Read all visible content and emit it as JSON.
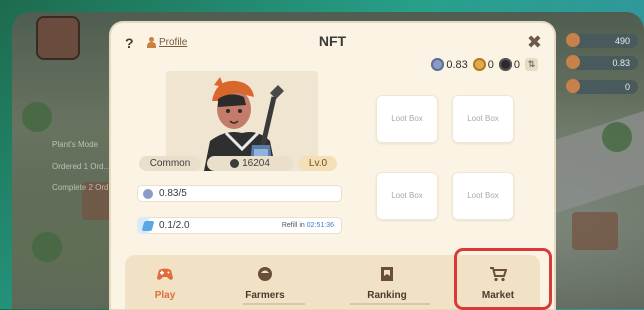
{
  "modal": {
    "title": "NFT",
    "help_symbol": "?",
    "profile_label": "Profile",
    "close_symbol": "✖"
  },
  "currencies": [
    {
      "icon": "token-icon",
      "value": "0.83",
      "color": "#8a9cc4"
    },
    {
      "icon": "gold-coin-icon",
      "value": "0",
      "color": "#e0a94a"
    },
    {
      "icon": "black-coin-icon",
      "value": "0",
      "color": "#2b2b2b"
    }
  ],
  "nft": {
    "rarity": "Common",
    "power": "16204",
    "level": "Lv.0",
    "hp": "0.83/5",
    "energy": "0.1/2.0",
    "refill_label": "Refill in",
    "refill_time": "02:51:36"
  },
  "lootboxes": [
    "Loot Box",
    "Loot Box",
    "Loot Box",
    "Loot Box"
  ],
  "nav": {
    "play": "Play",
    "farmers": "Farmers",
    "ranking": "Ranking",
    "market": "Market"
  },
  "hud": {
    "top_right": [
      "490",
      "0.83",
      "0"
    ],
    "side_labels": [
      "Plant's Mode",
      "Ordered 1 Ord...",
      "Complete 2 Ord..."
    ]
  },
  "colors": {
    "accent": "#e06b3b",
    "highlight": "#d83a3a",
    "modal_bg": "#fbf3e3"
  }
}
